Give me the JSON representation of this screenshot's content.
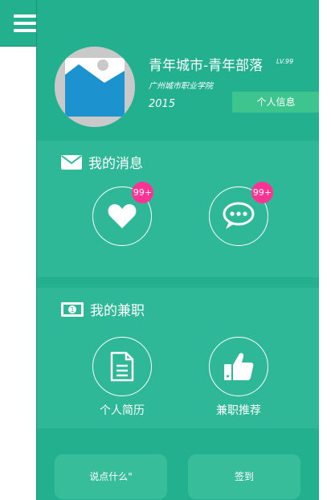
{
  "header": {
    "username": "青年城市-青年部落",
    "level": "LV.99",
    "school": "广州城市职业学院",
    "year": "2015",
    "profile_button": "个人信息"
  },
  "messages": {
    "title": "我的消息",
    "likes_badge": "99+",
    "comments_badge": "99+"
  },
  "jobs": {
    "title": "我的兼职",
    "resume_label": "个人简历",
    "recommend_label": "兼职推荐"
  },
  "footer": {
    "post_button": "说点什么\"",
    "checkin_button": "签到"
  },
  "colors": {
    "drawer": "#22b08f",
    "panel": "#2fb897",
    "badge": "#ff3393",
    "profile_button": "#3ec58f"
  }
}
